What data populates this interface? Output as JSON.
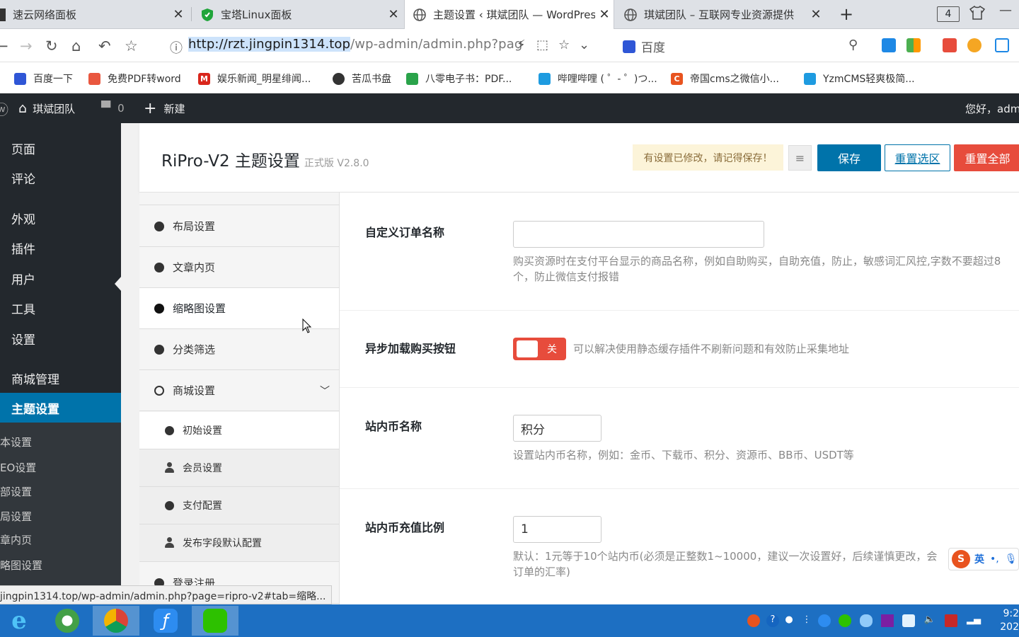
{
  "browser": {
    "tabs": [
      {
        "title": "速云网络面板",
        "active": false
      },
      {
        "title": "宝塔Linux面板",
        "active": false
      },
      {
        "title": "主题设置 ‹ 琪斌团队 — WordPress",
        "active": true
      },
      {
        "title": "琪斌团队 – 互联网专业资源提供",
        "active": false
      }
    ],
    "tab_count": "4",
    "url_host": "http://rzt.jingpin1314.top",
    "url_path": "/wp-admin/admin.php?pag",
    "search_engine": "百度",
    "bookmarks": [
      {
        "label": "百度一下",
        "color": "#2f56d6",
        "icon": "baidu-icon"
      },
      {
        "label": "免费PDF转word",
        "color": "#e9573f",
        "icon": "pdf-icon"
      },
      {
        "label": "娱乐新闻_明星绯闻...",
        "color": "#d9261c",
        "icon": "m-logo-icon"
      },
      {
        "label": "苦瓜书盘",
        "color": "#333333",
        "icon": "globe-icon"
      },
      {
        "label": "八零电子书：PDF...",
        "color": "#2aa34a",
        "icon": "book-icon"
      },
      {
        "label": "哔哩哔哩 ( ゜- ゜)つ...",
        "color": "#1e9be0",
        "icon": "bilibili-icon"
      },
      {
        "label": "帝国cms之微信小...",
        "color": "#e8531f",
        "icon": "c-logo-icon"
      },
      {
        "label": "YzmCMS轻爽极简...",
        "color": "#1e9be0",
        "icon": "bilibili-icon"
      }
    ]
  },
  "adminbar": {
    "site_name": "琪斌团队",
    "comments_count": "0",
    "new_label": "新建",
    "greeting": "您好，adm"
  },
  "sidebar": {
    "items": [
      {
        "label": "页面"
      },
      {
        "label": "评论"
      },
      {
        "label": "外观"
      },
      {
        "label": "插件"
      },
      {
        "label": "用户"
      },
      {
        "label": "工具"
      },
      {
        "label": "设置"
      },
      {
        "label": "商城管理"
      },
      {
        "label": "主题设置"
      }
    ],
    "subitems": [
      {
        "label": "本设置"
      },
      {
        "label": "EO设置"
      },
      {
        "label": "部设置"
      },
      {
        "label": "局设置"
      },
      {
        "label": "章内页"
      },
      {
        "label": "略图设置"
      }
    ]
  },
  "panel": {
    "title": "RiPro-V2 主题设置",
    "version": "正式版 V2.8.0",
    "notice": "有设置已修改，请记得保存！",
    "save": "保存",
    "reset_section": "重置选区",
    "reset_all": "重置全部"
  },
  "leftnav": {
    "items": [
      {
        "label": "布局设置"
      },
      {
        "label": "文章内页"
      },
      {
        "label": "缩略图设置"
      },
      {
        "label": "分类筛选"
      },
      {
        "label": "商城设置"
      }
    ],
    "subitems": [
      {
        "label": "初始设置"
      },
      {
        "label": "会员设置"
      },
      {
        "label": "支付配置"
      },
      {
        "label": "发布字段默认配置"
      }
    ],
    "next_item": "登录注册"
  },
  "fields": {
    "order_name": {
      "label": "自定义订单名称",
      "value": "",
      "desc": "购买资源时在支付平台显示的商品名称，例如自助购买，自助充值，防止，敏感词汇风控,字数不要超过8个，防止微信支付报错"
    },
    "async_buy": {
      "label": "异步加载购买按钮",
      "toggle_label": "关",
      "desc": "可以解决使用静态缓存插件不刷新问题和有效防止采集地址"
    },
    "coin_name": {
      "label": "站内币名称",
      "value": "积分",
      "desc": "设置站内币名称，例如：金币、下载币、积分、资源币、BB币、USDT等"
    },
    "coin_rate": {
      "label": "站内币充值比例",
      "value": "1",
      "desc": "默认：1元等于10个站内币(必须是正整数1~10000，建议一次设置好，后续谨慎更改，会",
      "desc2": "订单的汇率)"
    }
  },
  "status_url": "jingpin1314.top/wp-admin/admin.php?page=ripro-v2#tab=缩略...",
  "ime": {
    "lang": "英"
  },
  "clock": {
    "time": "9:2",
    "year": "202"
  }
}
